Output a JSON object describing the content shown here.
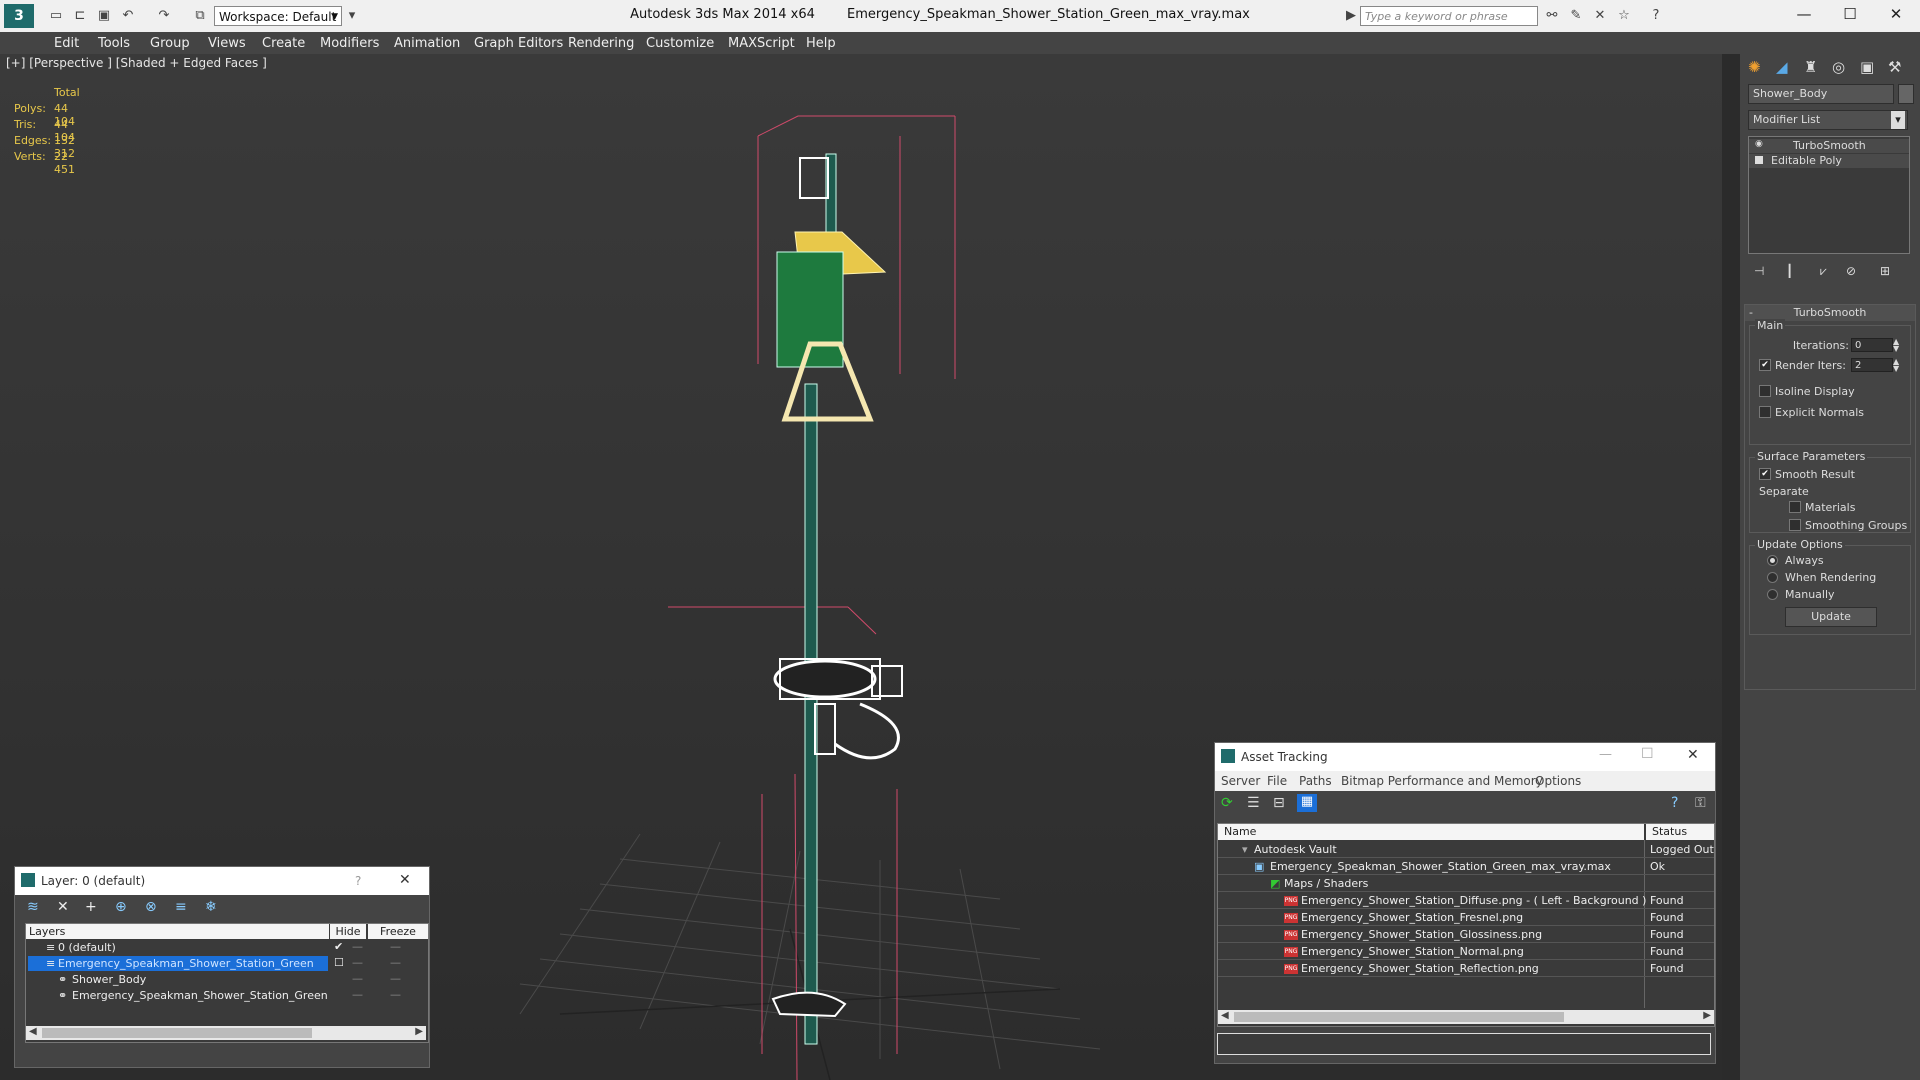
{
  "titlebar": {
    "app": "Autodesk 3ds Max  2014 x64",
    "file": "Emergency_Speakman_Shower_Station_Green_max_vray.max",
    "workspace": "Workspace: Default",
    "search_placeholder": "Type a keyword or phrase"
  },
  "menu": [
    "Edit",
    "Tools",
    "Group",
    "Views",
    "Create",
    "Modifiers",
    "Animation",
    "Graph Editors",
    "Rendering",
    "Customize",
    "MAXScript",
    "Help"
  ],
  "viewport": {
    "label": "[+] [Perspective ] [Shaded + Edged Faces ]",
    "stats": {
      "header": "Total",
      "rows": [
        {
          "k": "Polys:",
          "v": "44 104"
        },
        {
          "k": "Tris:",
          "v": "44 104"
        },
        {
          "k": "Edges:",
          "v": "132 312"
        },
        {
          "k": "Verts:",
          "v": "22 451"
        }
      ]
    }
  },
  "command_panel": {
    "object_name": "Shower_Body",
    "modifier_list": "Modifier List",
    "stack": [
      "TurboSmooth",
      "Editable Poly"
    ],
    "rollout_title": "TurboSmooth",
    "main_label": "Main",
    "iterations_label": "Iterations:",
    "iterations": "0",
    "render_iters_label": "Render Iters:",
    "render_iters": "2",
    "isoline": "Isoline Display",
    "explicit_normals": "Explicit Normals",
    "surface_params": "Surface Parameters",
    "smooth_result": "Smooth Result",
    "separate": "Separate",
    "materials": "Materials",
    "smoothing_groups": "Smoothing Groups",
    "update_options": "Update Options",
    "always": "Always",
    "when_rendering": "When Rendering",
    "manually": "Manually",
    "update_button": "Update"
  },
  "layer_window": {
    "title": "Layer: 0 (default)",
    "help": "?",
    "col_layers": "Layers",
    "col_hide": "Hide",
    "col_freeze": "Freeze",
    "rows": [
      "0 (default)",
      "Emergency_Speakman_Shower_Station_Green",
      "Shower_Body",
      "Emergency_Speakman_Shower_Station_Green"
    ]
  },
  "asset_window": {
    "title": "Asset Tracking",
    "menu": [
      "Server",
      "File",
      "Paths",
      "Bitmap Performance and Memory",
      "Options"
    ],
    "col_name": "Name",
    "col_status": "Status",
    "rows": [
      {
        "name": "Autodesk Vault",
        "status": "Logged Out"
      },
      {
        "name": "Emergency_Speakman_Shower_Station_Green_max_vray.max",
        "status": "Ok"
      },
      {
        "name": "Maps / Shaders",
        "status": ""
      },
      {
        "name": "Emergency_Shower_Station_Diffuse.png - ( Left - Background )",
        "status": "Found"
      },
      {
        "name": "Emergency_Shower_Station_Fresnel.png",
        "status": "Found"
      },
      {
        "name": "Emergency_Shower_Station_Glossiness.png",
        "status": "Found"
      },
      {
        "name": "Emergency_Shower_Station_Normal.png",
        "status": "Found"
      },
      {
        "name": "Emergency_Shower_Station_Reflection.png",
        "status": "Found"
      }
    ]
  },
  "colors": {
    "accent": "#3399ff",
    "selected_row": "#1b6fd8",
    "stats": "#e8c84a"
  }
}
